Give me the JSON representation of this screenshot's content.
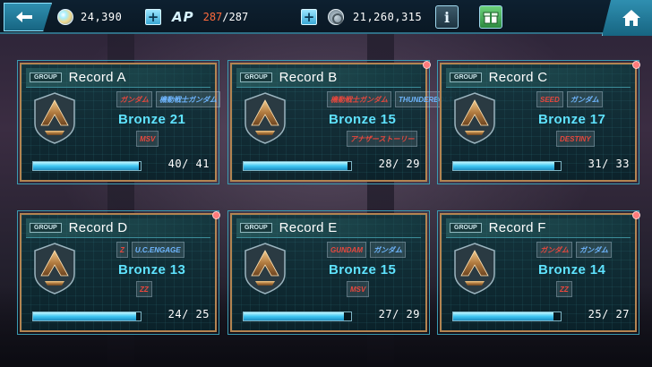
{
  "topbar": {
    "resource_1": "24,390",
    "ap_label": "AP",
    "ap_current": "287",
    "ap_max": "/287",
    "resource_2": "21,260,315",
    "info_label": "i",
    "accent_color": "#2f8fb0"
  },
  "cards": [
    {
      "group_tag": "GROUP",
      "name": "Record A",
      "rank": "Bronze 21",
      "progress_text": "40/ 41",
      "progress_fraction": 0.976,
      "logos_top": [
        "ガンダム",
        "機動戦士ガンダム"
      ],
      "logo_bottom": "MSV",
      "new": false
    },
    {
      "group_tag": "GROUP",
      "name": "Record B",
      "rank": "Bronze 15",
      "progress_text": "28/ 29",
      "progress_fraction": 0.966,
      "logos_top": [
        "機動戦士ガンダム",
        "THUNDERBOLT"
      ],
      "logo_bottom": "アナザーストーリー",
      "new": true
    },
    {
      "group_tag": "GROUP",
      "name": "Record C",
      "rank": "Bronze 17",
      "progress_text": "31/ 33",
      "progress_fraction": 0.939,
      "logos_top": [
        "SEED",
        "ガンダム"
      ],
      "logo_bottom": "DESTINY",
      "new": true
    },
    {
      "group_tag": "GROUP",
      "name": "Record D",
      "rank": "Bronze 13",
      "progress_text": "24/ 25",
      "progress_fraction": 0.96,
      "logos_top": [
        "Ζ",
        "U.C.ENGAGE"
      ],
      "logo_bottom": "ΖΖ",
      "new": true
    },
    {
      "group_tag": "GROUP",
      "name": "Record E",
      "rank": "Bronze 15",
      "progress_text": "27/ 29",
      "progress_fraction": 0.931,
      "logos_top": [
        "GUNDAM",
        "ガンダム"
      ],
      "logo_bottom": "MSV",
      "new": false
    },
    {
      "group_tag": "GROUP",
      "name": "Record F",
      "rank": "Bronze 14",
      "progress_text": "25/ 27",
      "progress_fraction": 0.926,
      "logos_top": [
        "ガンダム",
        "ガンダム"
      ],
      "logo_bottom": "ΖΖ",
      "new": true
    }
  ]
}
